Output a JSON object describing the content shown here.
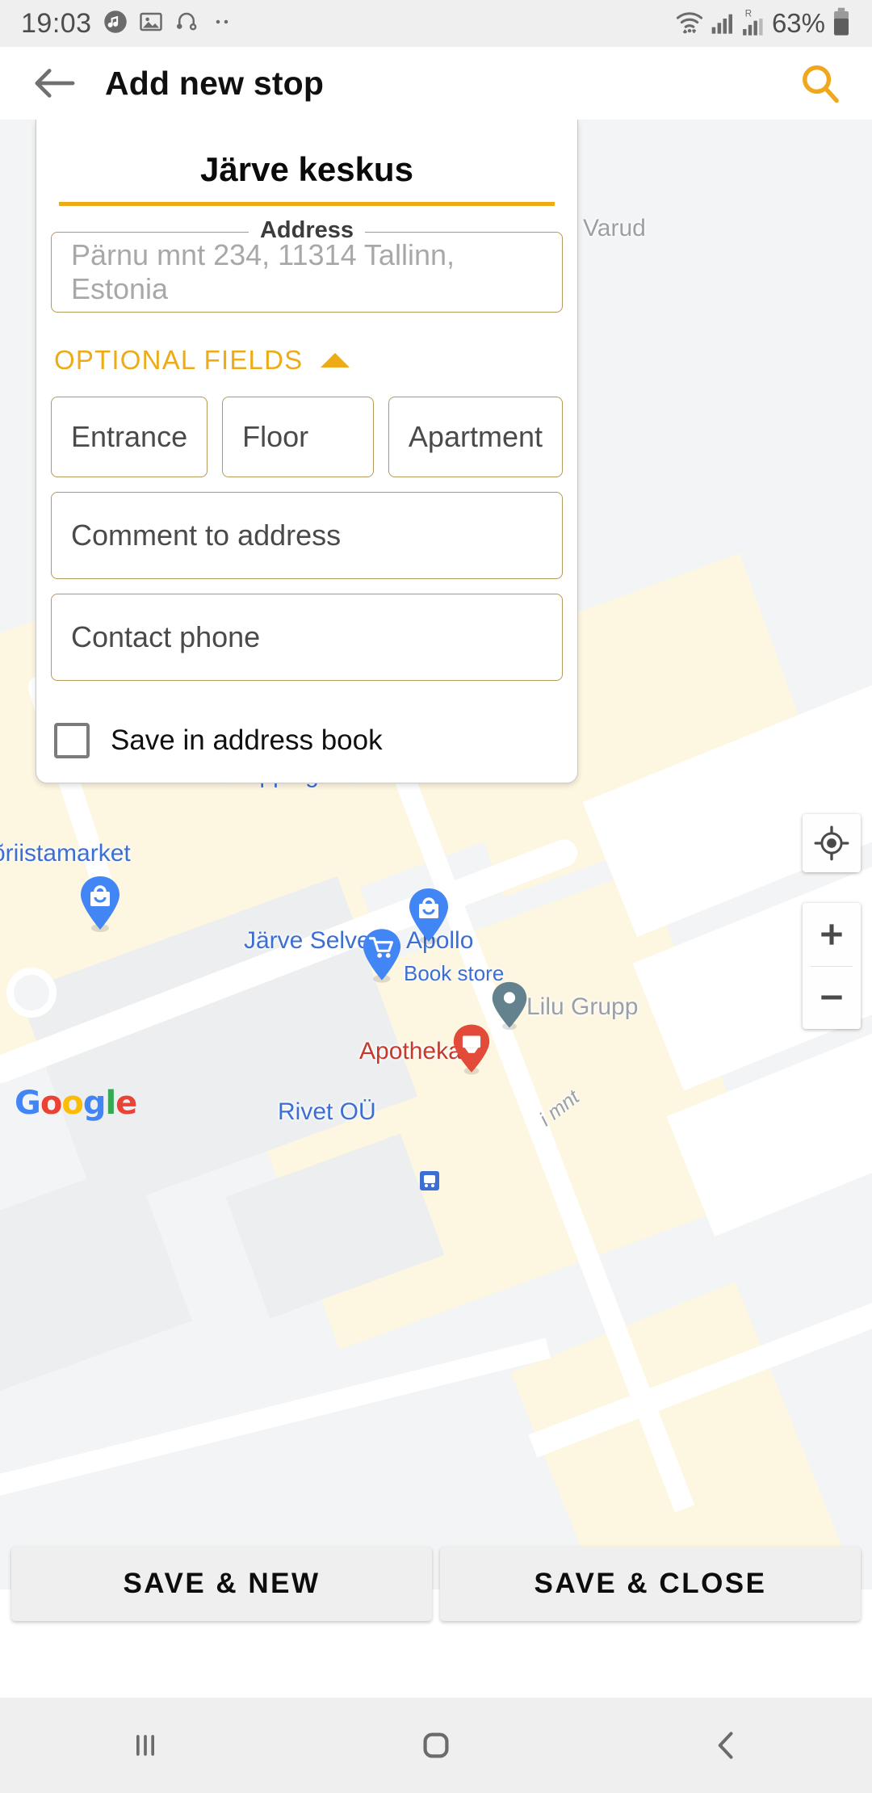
{
  "status_bar": {
    "time": "19:03",
    "battery_text": "63%",
    "icons": [
      "music-note-icon",
      "image-icon",
      "headphones-icon",
      "more-dots-icon",
      "wifi-icon",
      "signal-icon",
      "signal-roaming-icon",
      "battery-icon"
    ]
  },
  "app_bar": {
    "back_label": "back-arrow",
    "title": "Add new stop",
    "search_label": "search"
  },
  "form": {
    "stop_name": "Järve keskus",
    "address": {
      "legend": "Address",
      "value": "Pärnu mnt 234, 11314 Tallinn, Estonia"
    },
    "optional_section": {
      "label": "OPTIONAL FIELDS",
      "expanded": true
    },
    "entrance_placeholder": "Entrance",
    "floor_placeholder": "Floor",
    "apartment_placeholder": "Apartment",
    "comment_placeholder": "Comment to address",
    "phone_placeholder": "Contact phone",
    "save_address_book": {
      "label": "Save in address book",
      "checked": false
    }
  },
  "actions": {
    "save_new": "SAVE & NEW",
    "save_close": "SAVE & CLOSE"
  },
  "map": {
    "attribution": "Google",
    "labels": [
      {
        "text": "Varud",
        "kind": "grey"
      },
      {
        "text": "Shopping mall",
        "kind": "blue"
      },
      {
        "text": "õriistamarket",
        "kind": "blue"
      },
      {
        "text": "Järve Selver",
        "kind": "blue"
      },
      {
        "text": "Apollo",
        "kind": "blue"
      },
      {
        "text": "Book store",
        "kind": "blue"
      },
      {
        "text": "Lilu Grupp",
        "kind": "grey"
      },
      {
        "text": "Apotheka",
        "kind": "red"
      },
      {
        "text": "Rivet OÜ",
        "kind": "blue"
      },
      {
        "text": "i mnt",
        "kind": "italic"
      }
    ],
    "controls": {
      "locate": "my-location",
      "zoom_in": "+",
      "zoom_out": "−"
    }
  },
  "nav_bar": {
    "recents": "recents",
    "home": "home",
    "back": "back"
  },
  "colors": {
    "accent": "#eeab18",
    "field_border": "#b29a5d",
    "map_poi_blue": "#3c6fd4",
    "status_bg": "#efefef"
  }
}
